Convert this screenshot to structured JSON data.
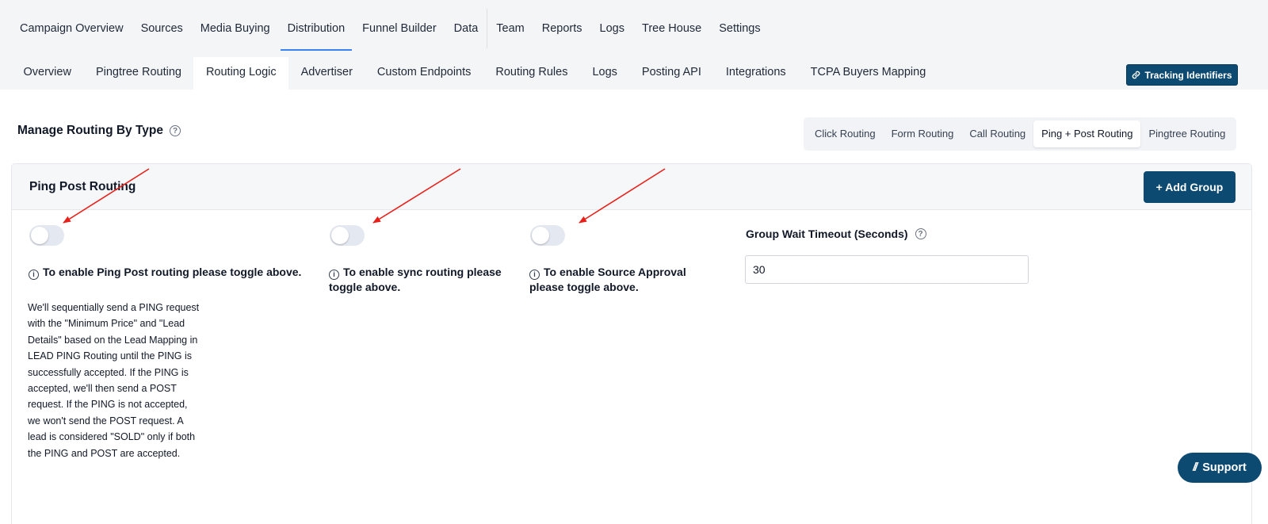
{
  "top_nav": {
    "items": [
      "Campaign Overview",
      "Sources",
      "Media Buying",
      "Distribution",
      "Funnel Builder",
      "Data",
      "Team",
      "Reports",
      "Logs",
      "Tree House",
      "Settings"
    ],
    "active": "Distribution"
  },
  "sub_nav": {
    "items": [
      "Overview",
      "Pingtree Routing",
      "Routing Logic",
      "Advertiser",
      "Custom Endpoints",
      "Routing Rules",
      "Logs",
      "Posting API",
      "Integrations",
      "TCPA Buyers Mapping"
    ],
    "active": "Routing Logic"
  },
  "tracking_button": {
    "label": "Tracking Identifiers",
    "icon": "link-icon"
  },
  "manage": {
    "title": "Manage Routing By Type",
    "help_icon": "?",
    "tabs": [
      "Click Routing",
      "Form Routing",
      "Call Routing",
      "Ping + Post Routing",
      "Pingtree Routing"
    ],
    "active_tab": "Ping + Post Routing"
  },
  "card": {
    "title": "Ping Post Routing",
    "add_button": "+ Add Group",
    "toggles": [
      {
        "name": "ping-post",
        "enabled": false,
        "note": "To enable Ping Post routing please toggle above."
      },
      {
        "name": "sync",
        "enabled": false,
        "note": "To enable sync routing please toggle above."
      },
      {
        "name": "source-approval",
        "enabled": false,
        "note": "To enable Source Approval please toggle above."
      }
    ],
    "info_icon": "i",
    "description": "We'll sequentially send a PING request with the \"Minimum Price\" and \"Lead Details\" based on the Lead Mapping in LEAD PING Routing until the PING is successfully accepted. If the PING is accepted, we'll then send a POST request. If the PING is not accepted, we won't send the POST request. A lead is considered \"SOLD\" only if both the PING and POST are accepted.",
    "group_wait": {
      "label": "Group Wait Timeout (Seconds)",
      "value": "30"
    }
  },
  "support": {
    "label": "Support",
    "icon_text": "//"
  },
  "colors": {
    "primary": "#0d4a72",
    "accent_underline": "#3b82f6",
    "annotation_arrow": "#e8201a",
    "toggle_off": "#e4e8f0"
  }
}
